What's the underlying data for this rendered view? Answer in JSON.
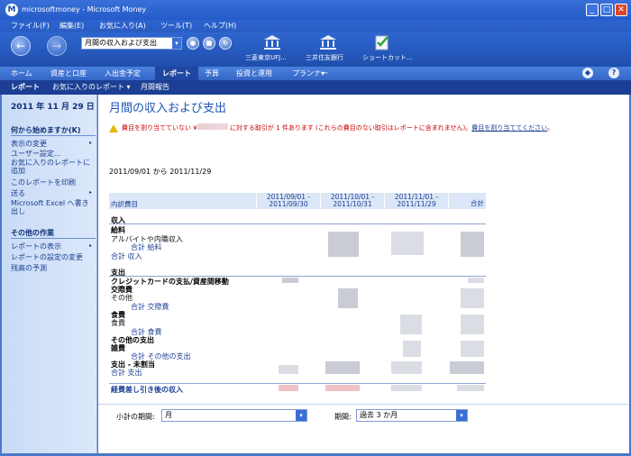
{
  "window": {
    "title": "microsoftmoney - Microsoft Money",
    "logo": "M",
    "minimize": "_",
    "maximize": "□",
    "close": "✕"
  },
  "menu": [
    "ファイル(F)",
    "編集(E)",
    "お気に入り(A)",
    "ツール(T)",
    "ヘルプ(H)"
  ],
  "toolbar": {
    "back": "←",
    "forward": "→",
    "address_value": "月間の収入および支出",
    "address_dd": "▾",
    "btn_go": "●",
    "btn_stop": "■",
    "btn_refresh": "↻",
    "shortcuts": [
      "三菱東京UFJ...",
      "三井住友銀行",
      "ショートカット..."
    ]
  },
  "tabs": [
    "ホーム",
    "資産と口座",
    "入出金予定",
    "レポート",
    "予算",
    "投資と運用",
    "プランナー"
  ],
  "tabs_extra": {
    "planner_dd": "▾",
    "icon_a": "◆",
    "help": "?"
  },
  "subnav": {
    "reports": "レポート",
    "favorites": "お気に入りのレポート ▾",
    "monthly": "月間報告"
  },
  "sidebar": {
    "date": "2011 年 11 月 29 日",
    "start_heading": "何から始めますか(K)",
    "start_items": [
      "表示の変更",
      "ユーザー設定...",
      "お気に入りのレポートに追加",
      "このレポートを印刷",
      "送る",
      "Microsoft Excel へ書き出し"
    ],
    "other_heading": "その他の作業",
    "other_items": [
      "レポートの表示",
      "レポートの設定の変更",
      "残高の予測"
    ],
    "arrow": "▸"
  },
  "main": {
    "title": "月間の収入および支出",
    "warning_prefix": "費目を割り当てていない ¥",
    "warning_mid": " に対する取引が 1 件あります (これらの費目のない取引はレポートに含まれません)。",
    "warning_link": "費目を割り当ててください",
    "warning_suffix": "。",
    "period_text": "2011/09/01 から 2011/11/29",
    "table": {
      "col0": "内訳費目",
      "col1": "2011/09/01 -\n2011/09/30",
      "col2": "2011/10/01 -\n2011/10/31",
      "col3": "2011/11/01 -\n2011/11/29",
      "col4": "合計"
    },
    "rows": [
      "収入",
      "給料",
      "アルバイトや内職収入",
      "合計 給料",
      "合計 収入",
      "支出",
      "クレジットカードの支払/資産間移動",
      "交際費",
      "その他",
      "合計 交際費",
      "食費",
      "食費",
      "合計 食費",
      "その他の支出",
      "雑費",
      "合計 その他の支出",
      "支出 - 未割当",
      "合計 支出",
      "経費差し引き後の収入"
    ],
    "subtotal_label": "小計の期間:",
    "subtotal_value": "月",
    "period_label": "期間:",
    "period_value": "過去 3 か月",
    "select_dd": "▾"
  }
}
